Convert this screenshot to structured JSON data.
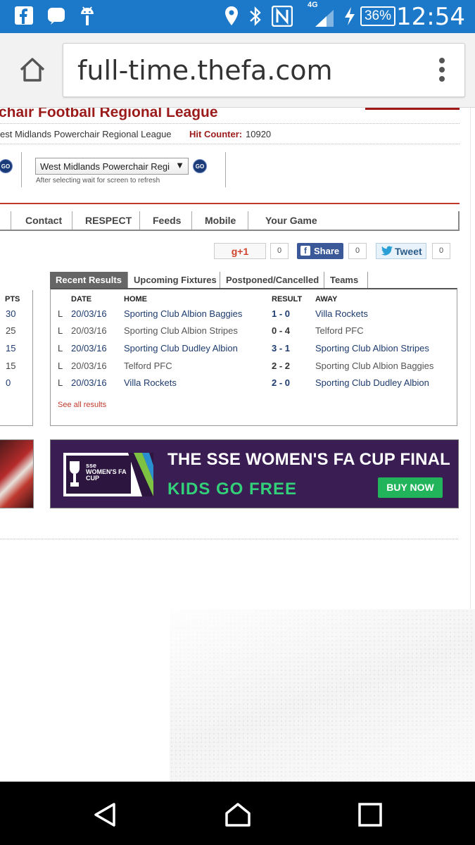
{
  "status_bar": {
    "time": "12:54",
    "battery": "36%",
    "network": "4G",
    "icons": [
      "facebook-icon",
      "messenger-icon",
      "android-icon",
      "location-icon",
      "bluetooth-icon",
      "nfc-icon",
      "signal-icon",
      "charging-icon"
    ]
  },
  "browser": {
    "url": "full-time.thefa.com"
  },
  "page": {
    "title": "chair Football Regional League",
    "breadcrumb": "est Midlands Powerchair Regional League",
    "hit_counter_label": "Hit Counter:",
    "hit_counter_value": "10920",
    "league_select": {
      "value": "West Midlands Powerchair Regi",
      "hint": "After selecting wait for screen to refresh",
      "go_label": "GO"
    },
    "nav": [
      "Contact",
      "RESPECT",
      "Feeds",
      "Mobile",
      "Your Game"
    ],
    "social": {
      "gplus_label": "g+1",
      "gplus_count": "0",
      "share_label": "Share",
      "share_count": "0",
      "tweet_label": "Tweet",
      "tweet_count": "0"
    },
    "standings": {
      "header": "PTS",
      "values": [
        "30",
        "25",
        "15",
        "15",
        "0"
      ]
    },
    "tabs": [
      "Recent Results",
      "Upcoming Fixtures",
      "Postponed/Cancelled",
      "Teams"
    ],
    "results": {
      "headers": {
        "date": "DATE",
        "home": "HOME",
        "result": "RESULT",
        "away": "AWAY"
      },
      "rows": [
        {
          "type": "L",
          "date": "20/03/16",
          "home": "Sporting Club Albion Baggies",
          "result": "1 - 0",
          "away": "Villa Rockets"
        },
        {
          "type": "L",
          "date": "20/03/16",
          "home": "Sporting Club Albion Stripes",
          "result": "0 - 4",
          "away": "Telford PFC"
        },
        {
          "type": "L",
          "date": "20/03/16",
          "home": "Sporting Club Dudley Albion",
          "result": "3 - 1",
          "away": "Sporting Club Albion Stripes"
        },
        {
          "type": "L",
          "date": "20/03/16",
          "home": "Telford PFC",
          "result": "2 - 2",
          "away": "Sporting Club Albion Baggies"
        },
        {
          "type": "L",
          "date": "20/03/16",
          "home": "Villa Rockets",
          "result": "2 - 0",
          "away": "Sporting Club Dudley Albion"
        }
      ],
      "see_all": "See all results"
    },
    "banner": {
      "title": "THE SSE WOMEN'S FA CUP FINAL",
      "subtitle": "KIDS GO FREE",
      "button": "BUY NOW",
      "logo_text": "sse WOMEN'S FA CUP"
    }
  },
  "colors": {
    "status_bar": "#1c78c8",
    "brand_red": "#9b1b1b",
    "link_blue": "#1d3b6e",
    "banner_purple": "#3a1d52",
    "banner_green": "#33d07a"
  }
}
